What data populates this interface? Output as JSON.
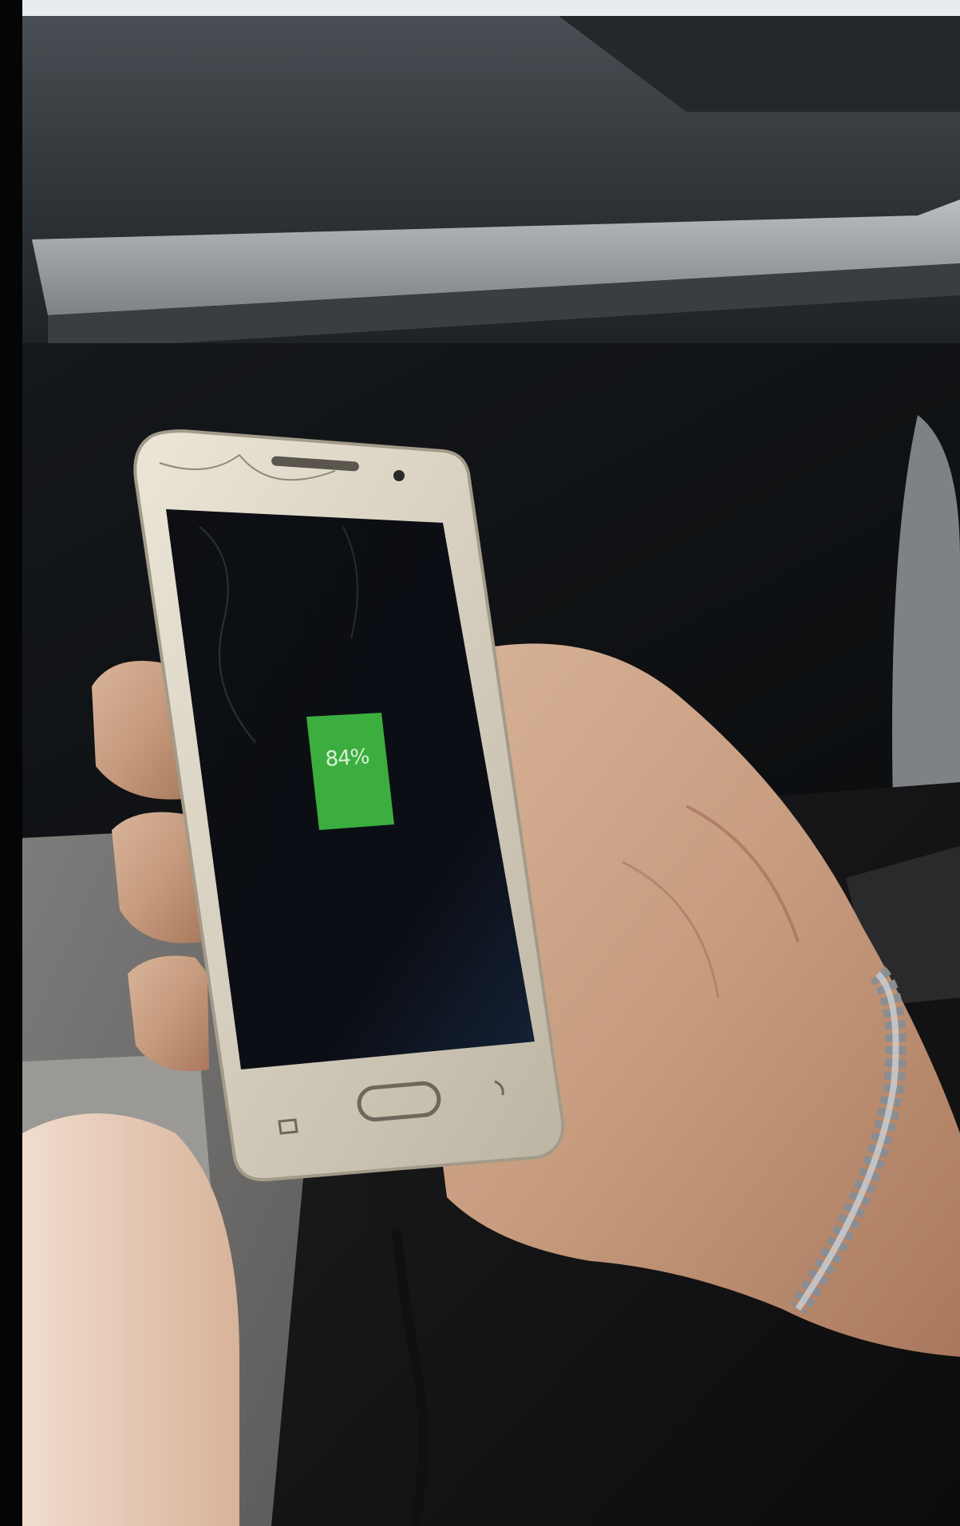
{
  "phone": {
    "battery_level": 84,
    "battery_text": "84%"
  },
  "colors": {
    "battery_fill": "#3cae3f",
    "screen": "#0b0d12",
    "phone_frame": "#d9d2c2"
  }
}
